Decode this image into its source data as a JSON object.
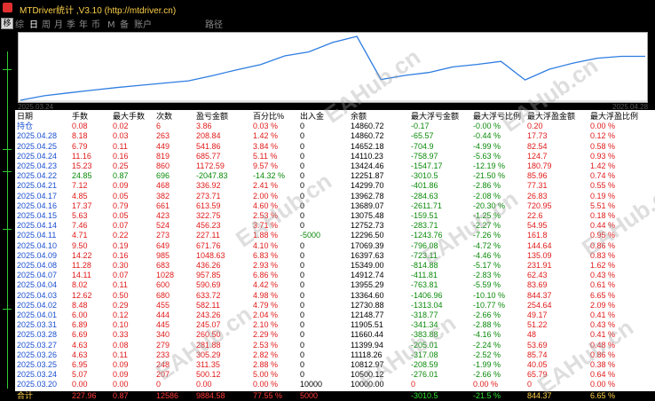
{
  "window": {
    "title": "MTDriver统计 ,V3.10 (http://mtdriver.cn)",
    "side_button_label": "移"
  },
  "tabs": [
    "综",
    "日",
    "周",
    "月",
    "季",
    "年",
    "币",
    "M",
    "备",
    "账户",
    "路径"
  ],
  "active_tab": 1,
  "chart": {
    "start_label": "2025.03.24",
    "end_label": "2025.04.28",
    "line_color": "#2e7de0",
    "start_value": 10000,
    "end_value": 14860.72
  },
  "watermark": "EAHub.cn",
  "columns": [
    "日期",
    "手数",
    "最大手数",
    "次数",
    "盈亏金额",
    "百分比%",
    "出入金",
    "余额",
    "最大浮亏金额",
    "最大浮亏比例",
    "最大浮盈金额",
    "最大浮盈比例"
  ],
  "rows": [
    [
      "持仓",
      "0.08",
      "0.02",
      "6",
      "3.86",
      "0.03 %",
      "0",
      "14860.72",
      "-0.17",
      "-0.00 %",
      "0.20",
      "0.00 %"
    ],
    [
      "2025.04.28",
      "8.18",
      "0.03",
      "263",
      "208.84",
      "1.42 %",
      "0",
      "14860.72",
      "-65.57",
      "-0.44 %",
      "17.73",
      "0.12 %"
    ],
    [
      "2025.04.25",
      "6.79",
      "0.11",
      "449",
      "541.86",
      "3.84 %",
      "0",
      "14652.18",
      "-704.9",
      "-4.99 %",
      "82.54",
      "0.58 %"
    ],
    [
      "2025.04.24",
      "11.16",
      "0.16",
      "819",
      "685.77",
      "5.11 %",
      "0",
      "14110.23",
      "-758.97",
      "-5.63 %",
      "124.7",
      "0.93 %"
    ],
    [
      "2025.04.23",
      "15.23",
      "0.25",
      "860",
      "1172.59",
      "9.57 %",
      "0",
      "13424.46",
      "-1547.17",
      "-12.19 %",
      "180.79",
      "1.42 %"
    ],
    [
      "2025.04.22",
      "24.85",
      "0.87",
      "696",
      "-2047.83",
      "-14.32 %",
      "0",
      "12251.87",
      "-3010.5",
      "-21.50 %",
      "85.96",
      "0.74 %"
    ],
    [
      "2025.04.21",
      "7.12",
      "0.09",
      "468",
      "336.92",
      "2.41 %",
      "0",
      "14299.70",
      "-401.86",
      "-2.86 %",
      "77.31",
      "0.55 %"
    ],
    [
      "2025.04.17",
      "4.85",
      "0.05",
      "382",
      "273.71",
      "2.00 %",
      "0",
      "13962.78",
      "-284.63",
      "-2.08 %",
      "26.83",
      "0.19 %"
    ],
    [
      "2025.04.16",
      "17.37",
      "0.79",
      "661",
      "613.59",
      "4.60 %",
      "0",
      "13689.07",
      "-2611.71",
      "-20.30 %",
      "720.95",
      "5.51 %"
    ],
    [
      "2025.04.15",
      "5.63",
      "0.05",
      "423",
      "322.75",
      "2.53 %",
      "0",
      "13075.48",
      "-159.51",
      "-1.25 %",
      "22.6",
      "0.18 %"
    ],
    [
      "2025.04.14",
      "7.46",
      "0.07",
      "524",
      "456.23",
      "3.71 %",
      "0",
      "12752.73",
      "-283.71",
      "-2.27 %",
      "54.95",
      "0.44 %"
    ],
    [
      "2025.04.11",
      "4.71",
      "0.22",
      "273",
      "227.11",
      "1.88 %",
      "-5000",
      "12296.50",
      "-1243.76",
      "-7.26 %",
      "161.8",
      "0.95 %"
    ],
    [
      "2025.04.10",
      "9.50",
      "0.19",
      "649",
      "671.76",
      "4.10 %",
      "0",
      "17069.39",
      "-796.08",
      "-4.72 %",
      "144.64",
      "0.86 %"
    ],
    [
      "2025.04.09",
      "14.22",
      "0.16",
      "985",
      "1048.63",
      "6.83 %",
      "0",
      "16397.63",
      "-723.11",
      "-4.46 %",
      "135.09",
      "0.83 %"
    ],
    [
      "2025.04.08",
      "11.28",
      "0.30",
      "683",
      "436.26",
      "2.93 %",
      "0",
      "15349.00",
      "-814.88",
      "-5.17 %",
      "231.91",
      "1.62 %"
    ],
    [
      "2025.04.07",
      "14.11",
      "0.07",
      "1028",
      "957.85",
      "6.86 %",
      "0",
      "14912.74",
      "-411.81",
      "-2.83 %",
      "62.43",
      "0.43 %"
    ],
    [
      "2025.04.04",
      "8.02",
      "0.11",
      "600",
      "590.69",
      "4.42 %",
      "0",
      "13955.29",
      "-763.81",
      "-5.59 %",
      "83.69",
      "0.61 %"
    ],
    [
      "2025.04.03",
      "12.62",
      "0.50",
      "680",
      "633.72",
      "4.98 %",
      "0",
      "13364.60",
      "-1406.96",
      "-10.10 %",
      "844.37",
      "6.65 %"
    ],
    [
      "2025.04.02",
      "8.48",
      "0.29",
      "455",
      "582.11",
      "4.79 %",
      "0",
      "12730.88",
      "-1313.04",
      "-10.77 %",
      "254.64",
      "2.09 %"
    ],
    [
      "2025.04.01",
      "6.00",
      "0.12",
      "444",
      "243.26",
      "2.04 %",
      "0",
      "12148.77",
      "-318.77",
      "-2.66 %",
      "49.17",
      "0.41 %"
    ],
    [
      "2025.03.31",
      "6.89",
      "0.10",
      "445",
      "245.07",
      "2.10 %",
      "0",
      "11905.51",
      "-341.34",
      "-2.88 %",
      "51.22",
      "0.43 %"
    ],
    [
      "2025.03.28",
      "6.69",
      "0.33",
      "340",
      "260.50",
      "2.29 %",
      "0",
      "11660.44",
      "-383.88",
      "-4.16 %",
      "48",
      "0.41 %"
    ],
    [
      "2025.03.27",
      "4.63",
      "0.08",
      "279",
      "281.88",
      "2.53 %",
      "0",
      "11399.94",
      "-205.01",
      "-2.24 %",
      "53.69",
      "0.48 %"
    ],
    [
      "2025.03.26",
      "4.63",
      "0.11",
      "233",
      "305.29",
      "2.82 %",
      "0",
      "11118.26",
      "-317.08",
      "-2.52 %",
      "85.74",
      "0.86 %"
    ],
    [
      "2025.03.25",
      "6.95",
      "0.09",
      "248",
      "311.35",
      "2.88 %",
      "0",
      "10812.97",
      "-208.59",
      "-1.99 %",
      "40.05",
      "0.38 %"
    ],
    [
      "2025.03.24",
      "5.07",
      "0.09",
      "207",
      "500.12",
      "5.00 %",
      "0",
      "10500.12",
      "-276.01",
      "-2.66 %",
      "65.79",
      "0.64 %"
    ],
    [
      "2025.03.20",
      "0.00",
      "0.00",
      "0",
      "0.00",
      "0.00 %",
      "10000",
      "10000.00",
      "0",
      "0.00 %",
      "0",
      "0.00 %"
    ]
  ],
  "total": [
    "合计",
    "227.96",
    "0.87",
    "12586",
    "9884.58",
    "77.55 %",
    "5000",
    "",
    "-3010.5",
    "-21.5 %",
    "844.37",
    "6.65 %"
  ]
}
